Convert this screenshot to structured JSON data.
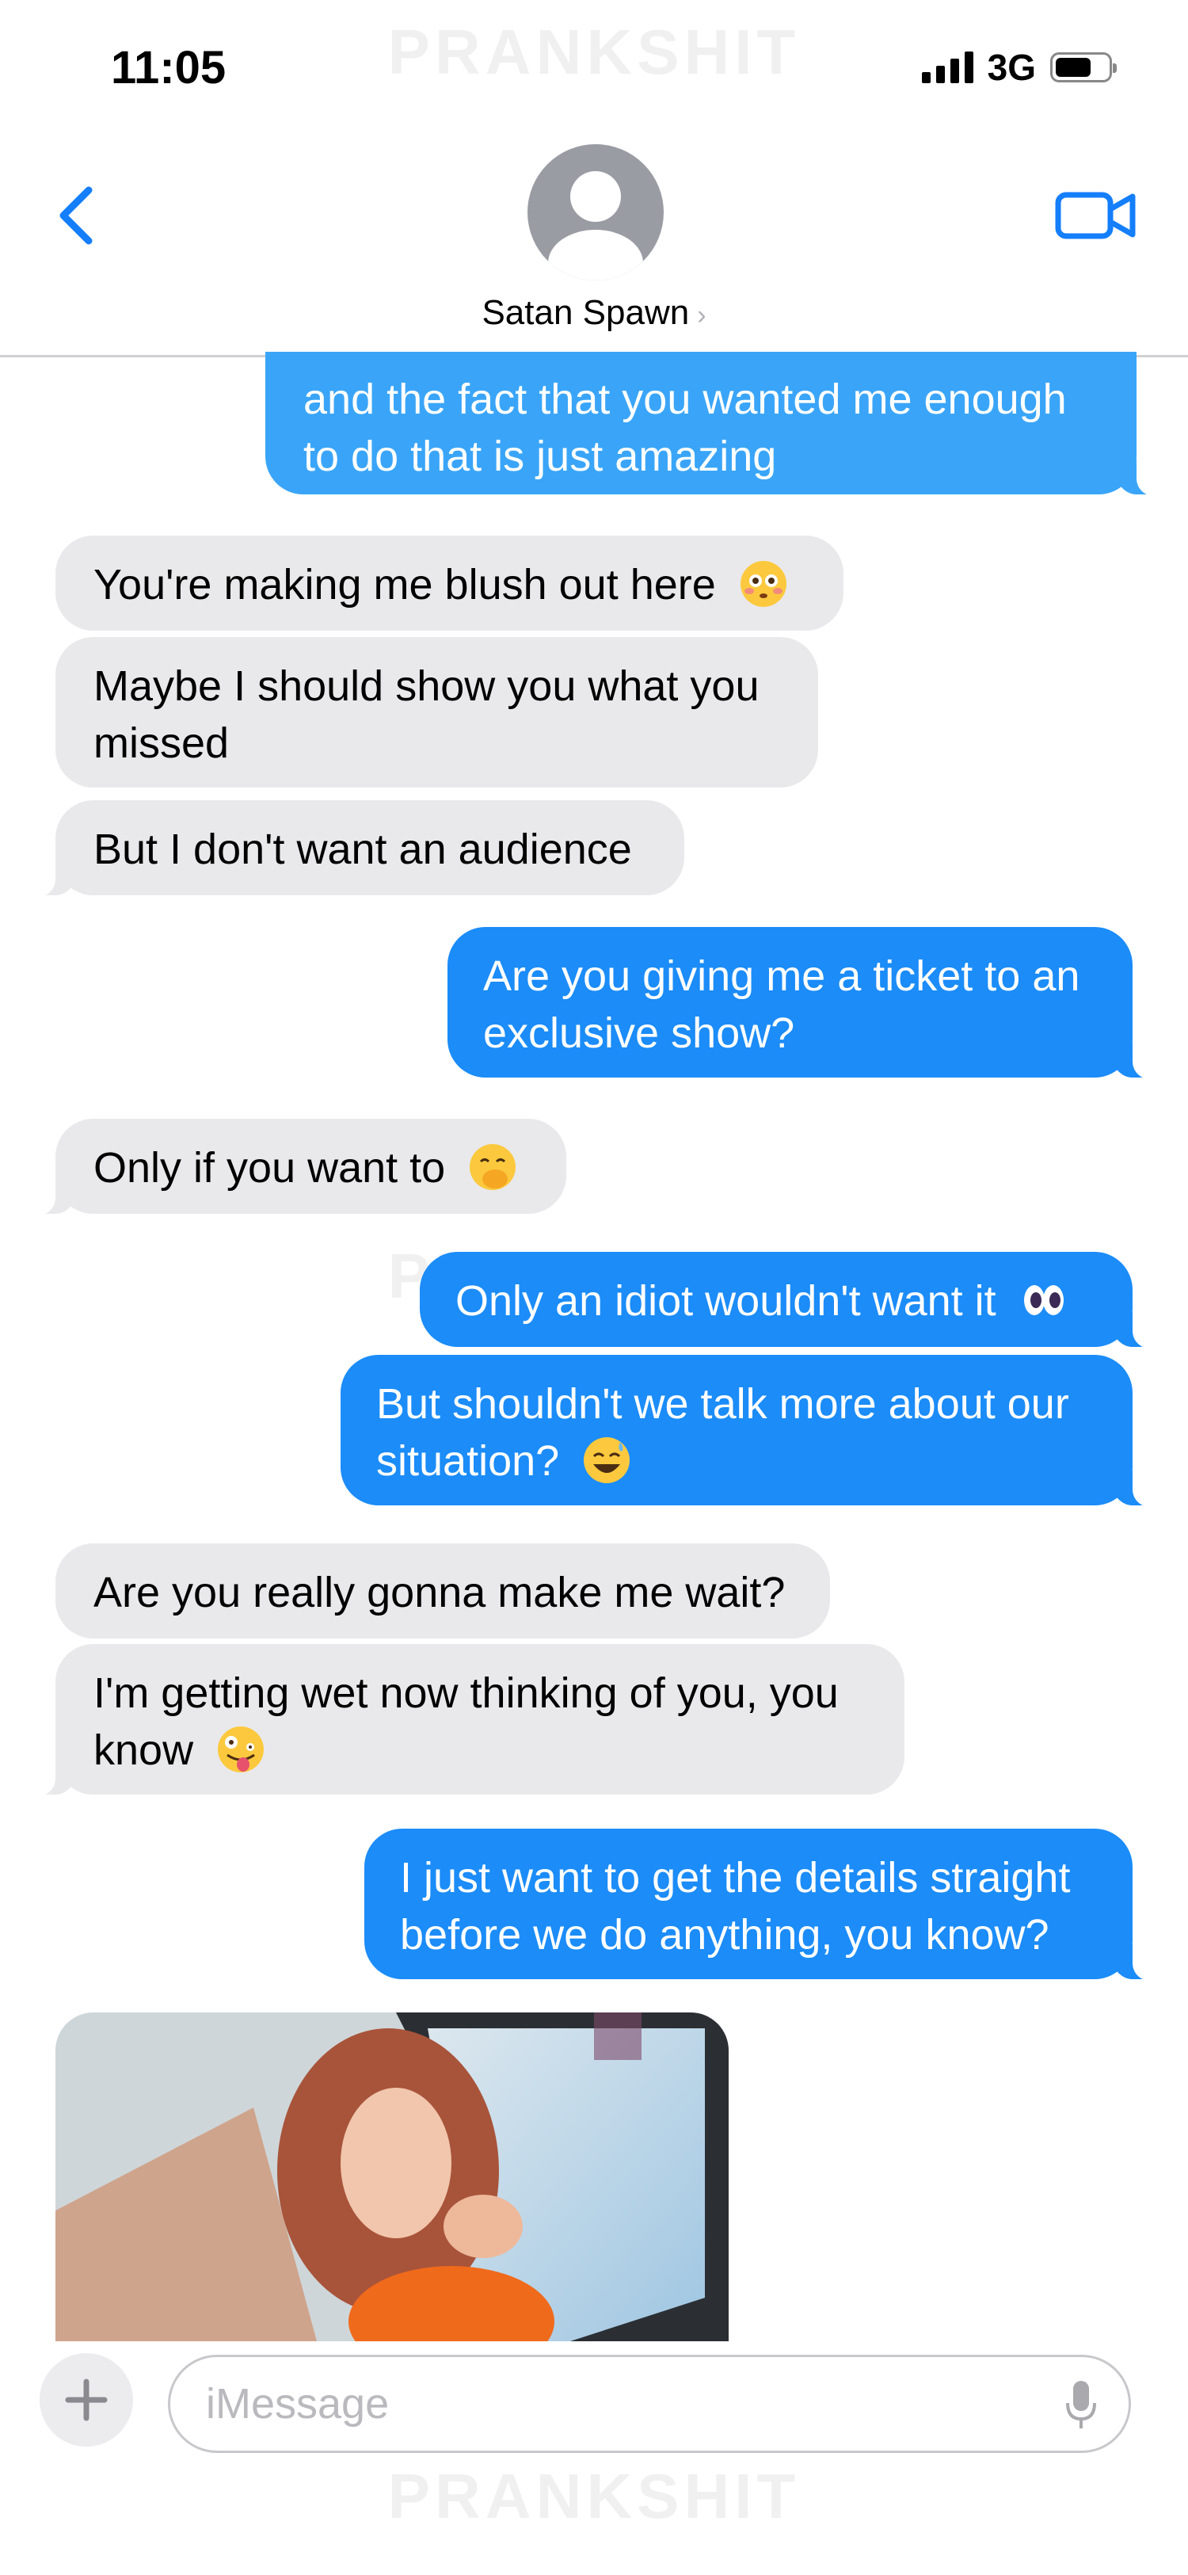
{
  "watermark": "PRANKSHIT",
  "status_bar": {
    "time": "11:05",
    "network": "3G"
  },
  "header": {
    "contact_name": "Satan Spawn",
    "chevron": "›"
  },
  "messages": [
    {
      "from": "me",
      "text": "and the fact that you wanted me enough to do that is just amazing"
    },
    {
      "from": "them",
      "text": "You're making me blush out here",
      "emoji": "flushed-face"
    },
    {
      "from": "them",
      "text": "Maybe I should show you what you missed"
    },
    {
      "from": "them",
      "text": "But I don't want an audience"
    },
    {
      "from": "me",
      "text": "Are you giving me a ticket to an exclusive show?"
    },
    {
      "from": "them",
      "text": "Only if you want to",
      "emoji": "face-with-hand-over-mouth"
    },
    {
      "from": "me",
      "text": "Only an idiot wouldn't want it",
      "emoji": "eyes"
    },
    {
      "from": "me",
      "text": "But shouldn't we talk more about our situation?",
      "emoji": "grinning-face-with-sweat"
    },
    {
      "from": "them",
      "text": "Are you really gonna make me wait?"
    },
    {
      "from": "them",
      "text": "I'm getting wet now thinking of you, you know",
      "emoji": "zany-face"
    },
    {
      "from": "me",
      "text": "I just want to get the details straight before we do anything, you know?"
    }
  ],
  "attachment": {
    "type": "photo"
  },
  "composer": {
    "placeholder": "iMessage"
  },
  "colors": {
    "outgoing": "#1b8cf8",
    "incoming": "#e9e9eb",
    "accent": "#147efb"
  },
  "icons": [
    "back-chevron-icon",
    "contact-avatar-icon",
    "video-camera-icon",
    "plus-icon",
    "microphone-icon"
  ]
}
